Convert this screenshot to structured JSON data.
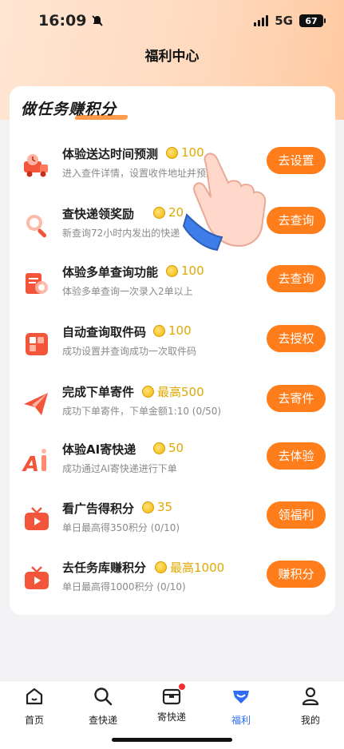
{
  "status_bar": {
    "time": "16:09",
    "network": "5G",
    "battery": "67"
  },
  "header": {
    "title": "福利中心"
  },
  "section": {
    "title": "做任务赚积分"
  },
  "tasks": [
    {
      "name": "体验送达时间预测",
      "reward": "100",
      "desc": "进入查件详情，设置收件地址并预测",
      "button": "去设置",
      "icon": "truck-clock-icon"
    },
    {
      "name": "查快递领奖励",
      "reward": "20",
      "desc": "新查询72小时内发出的快递",
      "button": "去查询",
      "icon": "magnifier-icon"
    },
    {
      "name": "体验多单查询功能",
      "reward": "100",
      "desc": "体验多单查询一次录入2单以上",
      "button": "去查询",
      "icon": "document-search-icon"
    },
    {
      "name": "自动查询取件码",
      "reward": "100",
      "desc": "成功设置并查询成功一次取件码",
      "button": "去授权",
      "icon": "code-grid-icon"
    },
    {
      "name": "完成下单寄件",
      "reward": "最高500",
      "desc": "成功下单寄件，下单金额1:10  (0/50)",
      "button": "去寄件",
      "icon": "paper-plane-icon"
    },
    {
      "name": "体验AI寄快递",
      "reward": "50",
      "desc": "成功通过AI寄快递进行下单",
      "button": "去体验",
      "icon": "ai-icon"
    },
    {
      "name": "看广告得积分",
      "reward": "35",
      "desc": "单日最高得350积分  (0/10)",
      "button": "领福利",
      "icon": "tv-icon"
    },
    {
      "name": "去任务库赚积分",
      "reward": "最高1000",
      "desc": "单日最高得1000积分  (0/10)",
      "button": "赚积分",
      "icon": "tv-icon"
    }
  ],
  "tabbar": [
    {
      "label": "首页",
      "icon": "home-icon",
      "active": false
    },
    {
      "label": "查快递",
      "icon": "search-icon",
      "active": false
    },
    {
      "label": "寄快递",
      "icon": "box-icon",
      "active": false
    },
    {
      "label": "福利",
      "icon": "gift-icon",
      "active": true
    },
    {
      "label": "我的",
      "icon": "user-icon",
      "active": false
    }
  ],
  "colors": {
    "accent": "#ff7d1a",
    "coin": "#e0a800",
    "active_tab": "#2f6df6"
  }
}
